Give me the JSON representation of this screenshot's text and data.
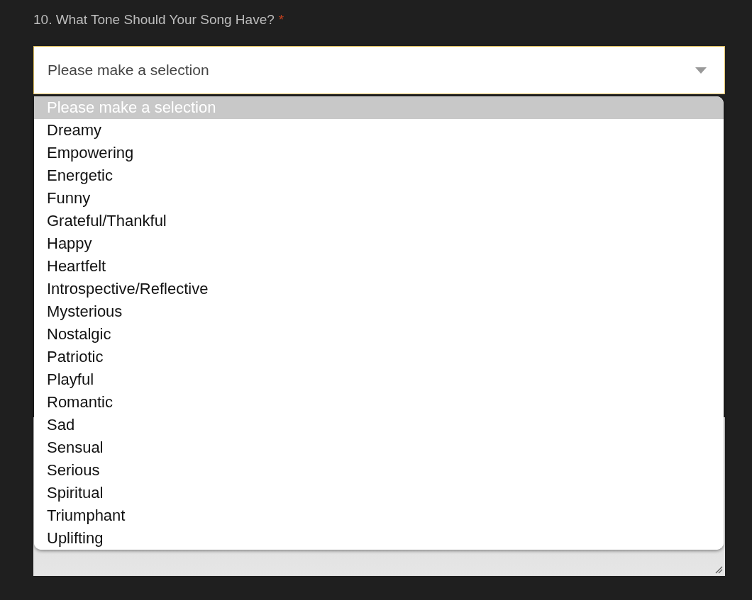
{
  "question": {
    "label": "10. What Tone Should Your Song Have?",
    "required_mark": "*"
  },
  "select": {
    "value": "Please make a selection",
    "expanded": true
  },
  "options": [
    {
      "label": "Please make a selection",
      "selected": true
    },
    {
      "label": "Dreamy",
      "selected": false
    },
    {
      "label": "Empowering",
      "selected": false
    },
    {
      "label": "Energetic",
      "selected": false
    },
    {
      "label": "Funny",
      "selected": false
    },
    {
      "label": "Grateful/Thankful",
      "selected": false
    },
    {
      "label": "Happy",
      "selected": false
    },
    {
      "label": "Heartfelt",
      "selected": false
    },
    {
      "label": "Introspective/Reflective",
      "selected": false
    },
    {
      "label": "Mysterious",
      "selected": false
    },
    {
      "label": "Nostalgic",
      "selected": false
    },
    {
      "label": "Patriotic",
      "selected": false
    },
    {
      "label": "Playful",
      "selected": false
    },
    {
      "label": "Romantic",
      "selected": false
    },
    {
      "label": "Sad",
      "selected": false
    },
    {
      "label": "Sensual",
      "selected": false
    },
    {
      "label": "Serious",
      "selected": false
    },
    {
      "label": "Spiritual",
      "selected": false
    },
    {
      "label": "Triumphant",
      "selected": false
    },
    {
      "label": "Uplifting",
      "selected": false
    }
  ]
}
